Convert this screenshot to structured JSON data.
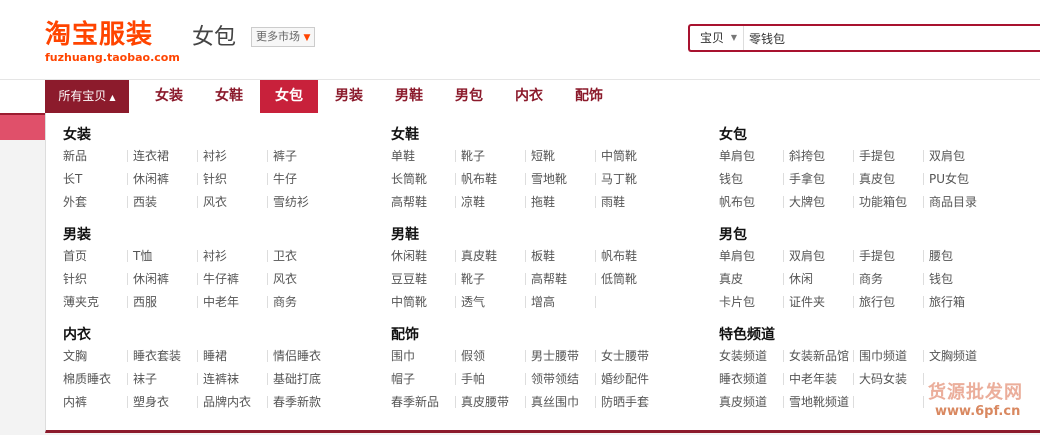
{
  "header": {
    "logo_text": "淘宝服装",
    "logo_url": "fuzhuang.taobao.com",
    "category_title": "女包",
    "more_markets": "更多市场"
  },
  "search": {
    "type_label": "宝贝",
    "query": "零钱包"
  },
  "nav": {
    "all_items": "所有宝贝",
    "items": [
      "女装",
      "女鞋",
      "女包",
      "男装",
      "男鞋",
      "男包",
      "内衣",
      "配饰"
    ],
    "active": "女包"
  },
  "sections": [
    {
      "title": "女装",
      "items": [
        "新品",
        "连衣裙",
        "衬衫",
        "裤子",
        "长T",
        "休闲裤",
        "针织",
        "牛仔",
        "外套",
        "西装",
        "风衣",
        "雪纺衫"
      ]
    },
    {
      "title": "女鞋",
      "items": [
        "单鞋",
        "靴子",
        "短靴",
        "中筒靴",
        "长筒靴",
        "帆布鞋",
        "雪地靴",
        "马丁靴",
        "高帮鞋",
        "凉鞋",
        "拖鞋",
        "雨鞋"
      ]
    },
    {
      "title": "女包",
      "items": [
        "单肩包",
        "斜挎包",
        "手提包",
        "双肩包",
        "钱包",
        "手拿包",
        "真皮包",
        "PU女包",
        "帆布包",
        "大牌包",
        "功能箱包",
        "商品目录"
      ]
    },
    {
      "title": "男装",
      "items": [
        "首页",
        "T恤",
        "衬衫",
        "卫衣",
        "针织",
        "休闲裤",
        "牛仔裤",
        "风衣",
        "薄夹克",
        "西服",
        "中老年",
        "商务"
      ]
    },
    {
      "title": "男鞋",
      "items": [
        "休闲鞋",
        "真皮鞋",
        "板鞋",
        "帆布鞋",
        "豆豆鞋",
        "靴子",
        "高帮鞋",
        "低筒靴",
        "中筒靴",
        "透气",
        "增高",
        ""
      ]
    },
    {
      "title": "男包",
      "items": [
        "单肩包",
        "双肩包",
        "手提包",
        "腰包",
        "真皮",
        "休闲",
        "商务",
        "钱包",
        "卡片包",
        "证件夹",
        "旅行包",
        "旅行箱"
      ]
    },
    {
      "title": "内衣",
      "items": [
        "文胸",
        "睡衣套装",
        "睡裙",
        "情侣睡衣",
        "棉质睡衣",
        "袜子",
        "连裤袜",
        "基础打底",
        "内裤",
        "塑身衣",
        "品牌内衣",
        "春季新款"
      ]
    },
    {
      "title": "配饰",
      "items": [
        "围巾",
        "假领",
        "男士腰带",
        "女士腰带",
        "帽子",
        "手帕",
        "领带领结",
        "婚纱配件",
        "春季新品",
        "真皮腰带",
        "真丝围巾",
        "防晒手套"
      ]
    },
    {
      "title": "特色频道",
      "items": [
        "女装频道",
        "女装新品馆",
        "围巾频道",
        "文胸频道",
        "睡衣频道",
        "中老年装",
        "大码女装",
        "",
        "真皮频道",
        "雪地靴频道",
        "",
        ""
      ]
    }
  ],
  "watermark": {
    "text_1": "货源批发网",
    "text_2": "www.6pf.cn"
  },
  "colors": {
    "brand_orange": "#ff4400",
    "nav_dark_red": "#8c1b2c",
    "nav_active": "#c8213b",
    "band_pink": "#e0506a"
  }
}
